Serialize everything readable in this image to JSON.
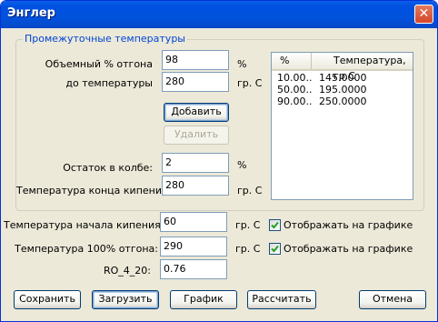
{
  "window": {
    "title": "Энглер",
    "close_symbol": "✕"
  },
  "group": {
    "legend": "Промежуточные температуры",
    "volume_label": "Объемный % отгона",
    "volume_value": "98",
    "volume_unit": "%",
    "temp_label": "до температуры",
    "temp_value": "280",
    "temp_unit": "гр. С",
    "add_button": "Добавить",
    "delete_button": "Удалить",
    "residue_label": "Остаток в колбе:",
    "residue_value": "2",
    "residue_unit": "%",
    "end_boil_label": "Температура конца кипения:",
    "end_boil_value": "280",
    "end_boil_unit": "гр. С"
  },
  "list": {
    "columns": [
      "%",
      "Температура, гр.С"
    ],
    "rows": [
      {
        "pct": "10.00...",
        "temp": "145.0000"
      },
      {
        "pct": "50.00...",
        "temp": "195.0000"
      },
      {
        "pct": "90.00...",
        "temp": "250.0000"
      }
    ]
  },
  "start_boil": {
    "label": "Температура начала кипения:",
    "value": "60",
    "unit": "гр. С",
    "checkbox_label": "Отображать на графике",
    "checked": true
  },
  "full_distill": {
    "label": "Температура 100% отгона:",
    "value": "290",
    "unit": "гр. С",
    "checkbox_label": "Отображать на графике",
    "checked": true
  },
  "ro": {
    "label": "RO_4_20:",
    "value": "0.76"
  },
  "buttons": {
    "save": "Сохранить",
    "load": "Загрузить",
    "chart": "График",
    "calculate": "Рассчитать",
    "cancel": "Отмена"
  }
}
